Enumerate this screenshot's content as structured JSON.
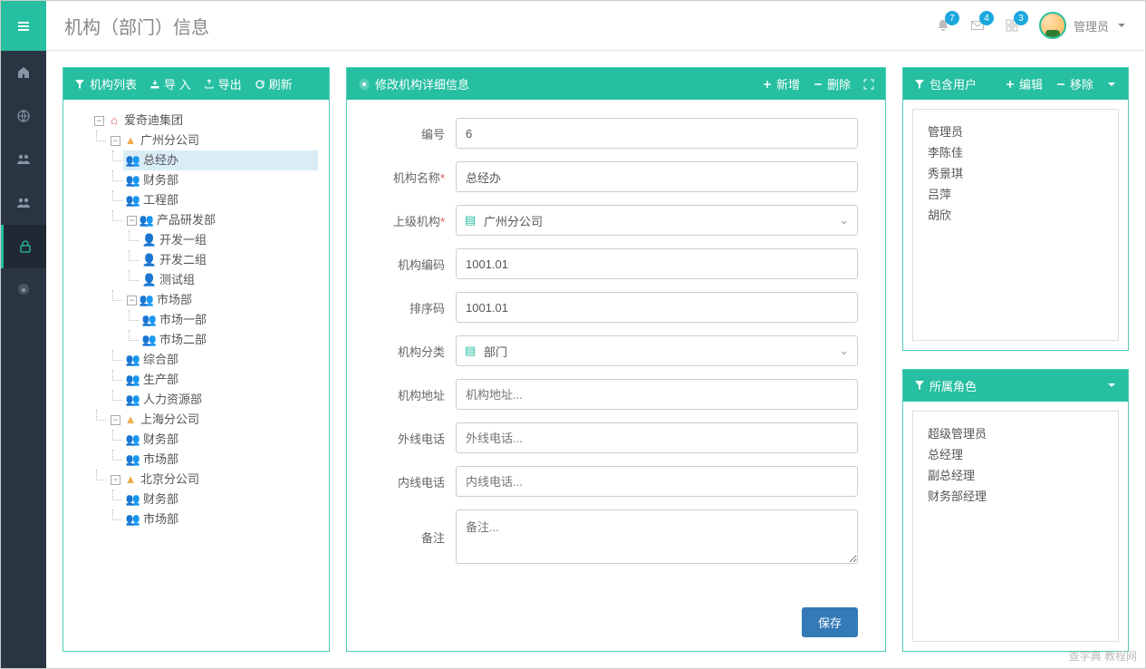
{
  "page_title": "机构（部门）信息",
  "top_badges": {
    "bell": "7",
    "mail": "4",
    "grid": "3"
  },
  "user": {
    "name": "管理员"
  },
  "tree_panel": {
    "title": "机构列表",
    "import": "导 入",
    "export": "导出",
    "refresh": "刷新"
  },
  "tree": {
    "root": "爱奇迪集团",
    "gz": "广州分公司",
    "gz_children": {
      "zjb": "总经办",
      "cwb": "财务部",
      "gcb": "工程部",
      "cpyf": "产品研发部",
      "kf1": "开发一组",
      "kf2": "开发二组",
      "csz": "测试组",
      "scb": "市场部",
      "sc1": "市场一部",
      "sc2": "市场二部",
      "zhb": "综合部",
      "prod": "生产部",
      "hr": "人力资源部"
    },
    "sh": "上海分公司",
    "sh_children": {
      "cwb": "财务部",
      "scb": "市场部"
    },
    "bj": "北京分公司",
    "bj_children": {
      "cwb": "财务部",
      "scb": "市场部"
    }
  },
  "form_panel": {
    "title": "修改机构详细信息",
    "add": "新增",
    "delete": "删除"
  },
  "form": {
    "labels": {
      "id": "编号",
      "name": "机构名称",
      "parent": "上级机构",
      "code": "机构编码",
      "sort": "排序码",
      "category": "机构分类",
      "address": "机构地址",
      "phone_ext": "外线电话",
      "phone_int": "内线电话",
      "remark": "备注"
    },
    "values": {
      "id": "6",
      "name": "总经办",
      "parent": "广州分公司",
      "code": "1001.01",
      "sort": "1001.01",
      "category": "部门"
    },
    "placeholders": {
      "address": "机构地址...",
      "phone_ext": "外线电话...",
      "phone_int": "内线电话...",
      "remark": "备注..."
    },
    "save": "保存"
  },
  "users_panel": {
    "title": "包含用户",
    "edit": "编辑",
    "remove": "移除",
    "items": [
      "管理员",
      "李陈佳",
      "秀景琪",
      "吕萍",
      "胡欣"
    ]
  },
  "roles_panel": {
    "title": "所属角色",
    "items": [
      "超级管理员",
      "总经理",
      "副总经理",
      "财务部经理"
    ]
  },
  "watermark": "查字典 教程网"
}
